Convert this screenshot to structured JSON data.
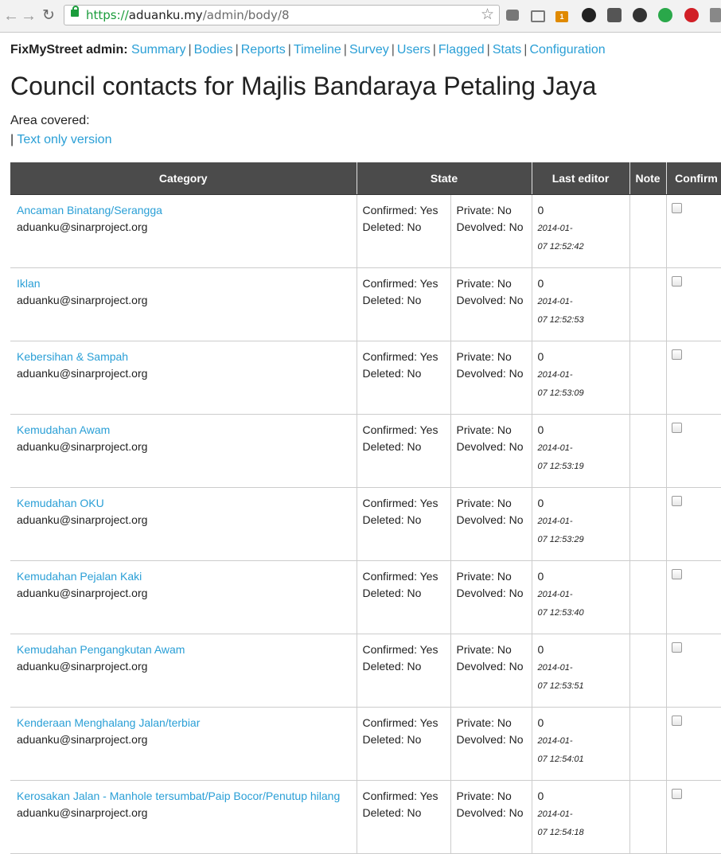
{
  "browser": {
    "url_scheme": "https://",
    "url_host": "aduanku.my",
    "url_path": "/admin/body/8",
    "ext_badge": "1"
  },
  "admin_nav": {
    "label": "FixMyStreet admin:",
    "links": [
      "Summary",
      "Bodies",
      "Reports",
      "Timeline",
      "Survey",
      "Users",
      "Flagged",
      "Stats",
      "Configuration"
    ],
    "separator": "|"
  },
  "page": {
    "title": "Council contacts for Majlis Bandaraya Petaling Jaya",
    "area_covered": "Area covered:",
    "text_only_prefix": "|",
    "text_only_link": "Text only version"
  },
  "table": {
    "headers": [
      "Category",
      "State",
      "Last editor",
      "Note",
      "Confirm"
    ],
    "rows": [
      {
        "category": "Ancaman Binatang/Serangga",
        "email": "aduanku@sinarproject.org",
        "confirmed": "Confirmed: Yes",
        "deleted": "Deleted: No",
        "private": "Private: No",
        "devolved": "Devolved: No",
        "editor": "0",
        "date": "2014-01-",
        "time": "07 12:52:42",
        "note": ""
      },
      {
        "category": "Iklan",
        "email": "aduanku@sinarproject.org",
        "confirmed": "Confirmed: Yes",
        "deleted": "Deleted: No",
        "private": "Private: No",
        "devolved": "Devolved: No",
        "editor": "0",
        "date": "2014-01-",
        "time": "07 12:52:53",
        "note": ""
      },
      {
        "category": "Kebersihan & Sampah",
        "email": "aduanku@sinarproject.org",
        "confirmed": "Confirmed: Yes",
        "deleted": "Deleted: No",
        "private": "Private: No",
        "devolved": "Devolved: No",
        "editor": "0",
        "date": "2014-01-",
        "time": "07 12:53:09",
        "note": ""
      },
      {
        "category": "Kemudahan Awam",
        "email": "aduanku@sinarproject.org",
        "confirmed": "Confirmed: Yes",
        "deleted": "Deleted: No",
        "private": "Private: No",
        "devolved": "Devolved: No",
        "editor": "0",
        "date": "2014-01-",
        "time": "07 12:53:19",
        "note": ""
      },
      {
        "category": "Kemudahan OKU",
        "email": "aduanku@sinarproject.org",
        "confirmed": "Confirmed: Yes",
        "deleted": "Deleted: No",
        "private": "Private: No",
        "devolved": "Devolved: No",
        "editor": "0",
        "date": "2014-01-",
        "time": "07 12:53:29",
        "note": ""
      },
      {
        "category": "Kemudahan Pejalan Kaki",
        "email": "aduanku@sinarproject.org",
        "confirmed": "Confirmed: Yes",
        "deleted": "Deleted: No",
        "private": "Private: No",
        "devolved": "Devolved: No",
        "editor": "0",
        "date": "2014-01-",
        "time": "07 12:53:40",
        "note": ""
      },
      {
        "category": "Kemudahan Pengangkutan Awam",
        "email": "aduanku@sinarproject.org",
        "confirmed": "Confirmed: Yes",
        "deleted": "Deleted: No",
        "private": "Private: No",
        "devolved": "Devolved: No",
        "editor": "0",
        "date": "2014-01-",
        "time": "07 12:53:51",
        "note": ""
      },
      {
        "category": "Kenderaan Menghalang Jalan/terbiar",
        "email": "aduanku@sinarproject.org",
        "confirmed": "Confirmed: Yes",
        "deleted": "Deleted: No",
        "private": "Private: No",
        "devolved": "Devolved: No",
        "editor": "0",
        "date": "2014-01-",
        "time": "07 12:54:01",
        "note": ""
      },
      {
        "category": "Kerosakan Jalan - Manhole tersumbat/Paip Bocor/Penutup hilang",
        "email": "aduanku@sinarproject.org",
        "confirmed": "Confirmed: Yes",
        "deleted": "Deleted: No",
        "private": "Private: No",
        "devolved": "Devolved: No",
        "editor": "0",
        "date": "2014-01-",
        "time": "07 12:54:18",
        "note": ""
      }
    ]
  }
}
